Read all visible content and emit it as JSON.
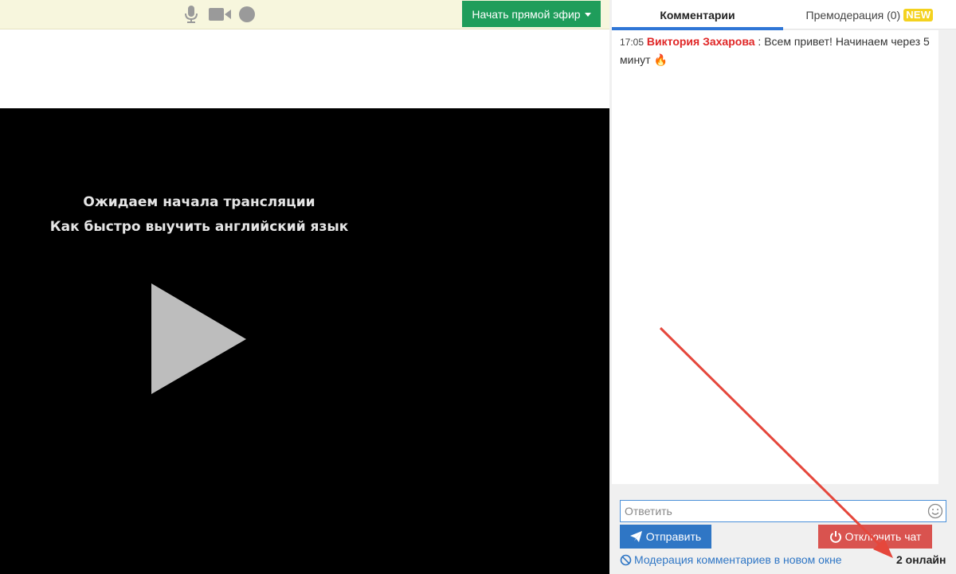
{
  "toolbar": {
    "icons": [
      "microphone-icon",
      "video-camera-icon",
      "record-icon"
    ],
    "live_button_label": "Начать прямой эфир",
    "live_button_color": "#1f9d5b"
  },
  "video": {
    "line1": "Ожидаем начала трансляции",
    "line2": "Как быстро выучить английский язык",
    "icon": "play-icon"
  },
  "tabs": [
    {
      "label": "Комментарии",
      "active": true
    },
    {
      "label": "Премодерация (0)",
      "badge": "NEW"
    }
  ],
  "messages": [
    {
      "time": "17:05",
      "author": "Виктория Захарова",
      "separator": " : ",
      "text": "Всем привет! Начинаем через 5 минут",
      "emoji": "🔥"
    }
  ],
  "reply": {
    "placeholder": "Ответить",
    "emoji_icon": "smile-icon"
  },
  "buttons": {
    "send_label": "Отправить",
    "disable_chat_label": "Отключить чат"
  },
  "footer": {
    "moderation_link": "Модерация комментариев в новом окне",
    "online": "2 онлайн"
  },
  "colors": {
    "accent_blue": "#2f76c5",
    "author_red": "#e02626",
    "danger": "#d9534f",
    "annotation_arrow": "#e5473c",
    "badge_yellow": "#f4d21f"
  }
}
